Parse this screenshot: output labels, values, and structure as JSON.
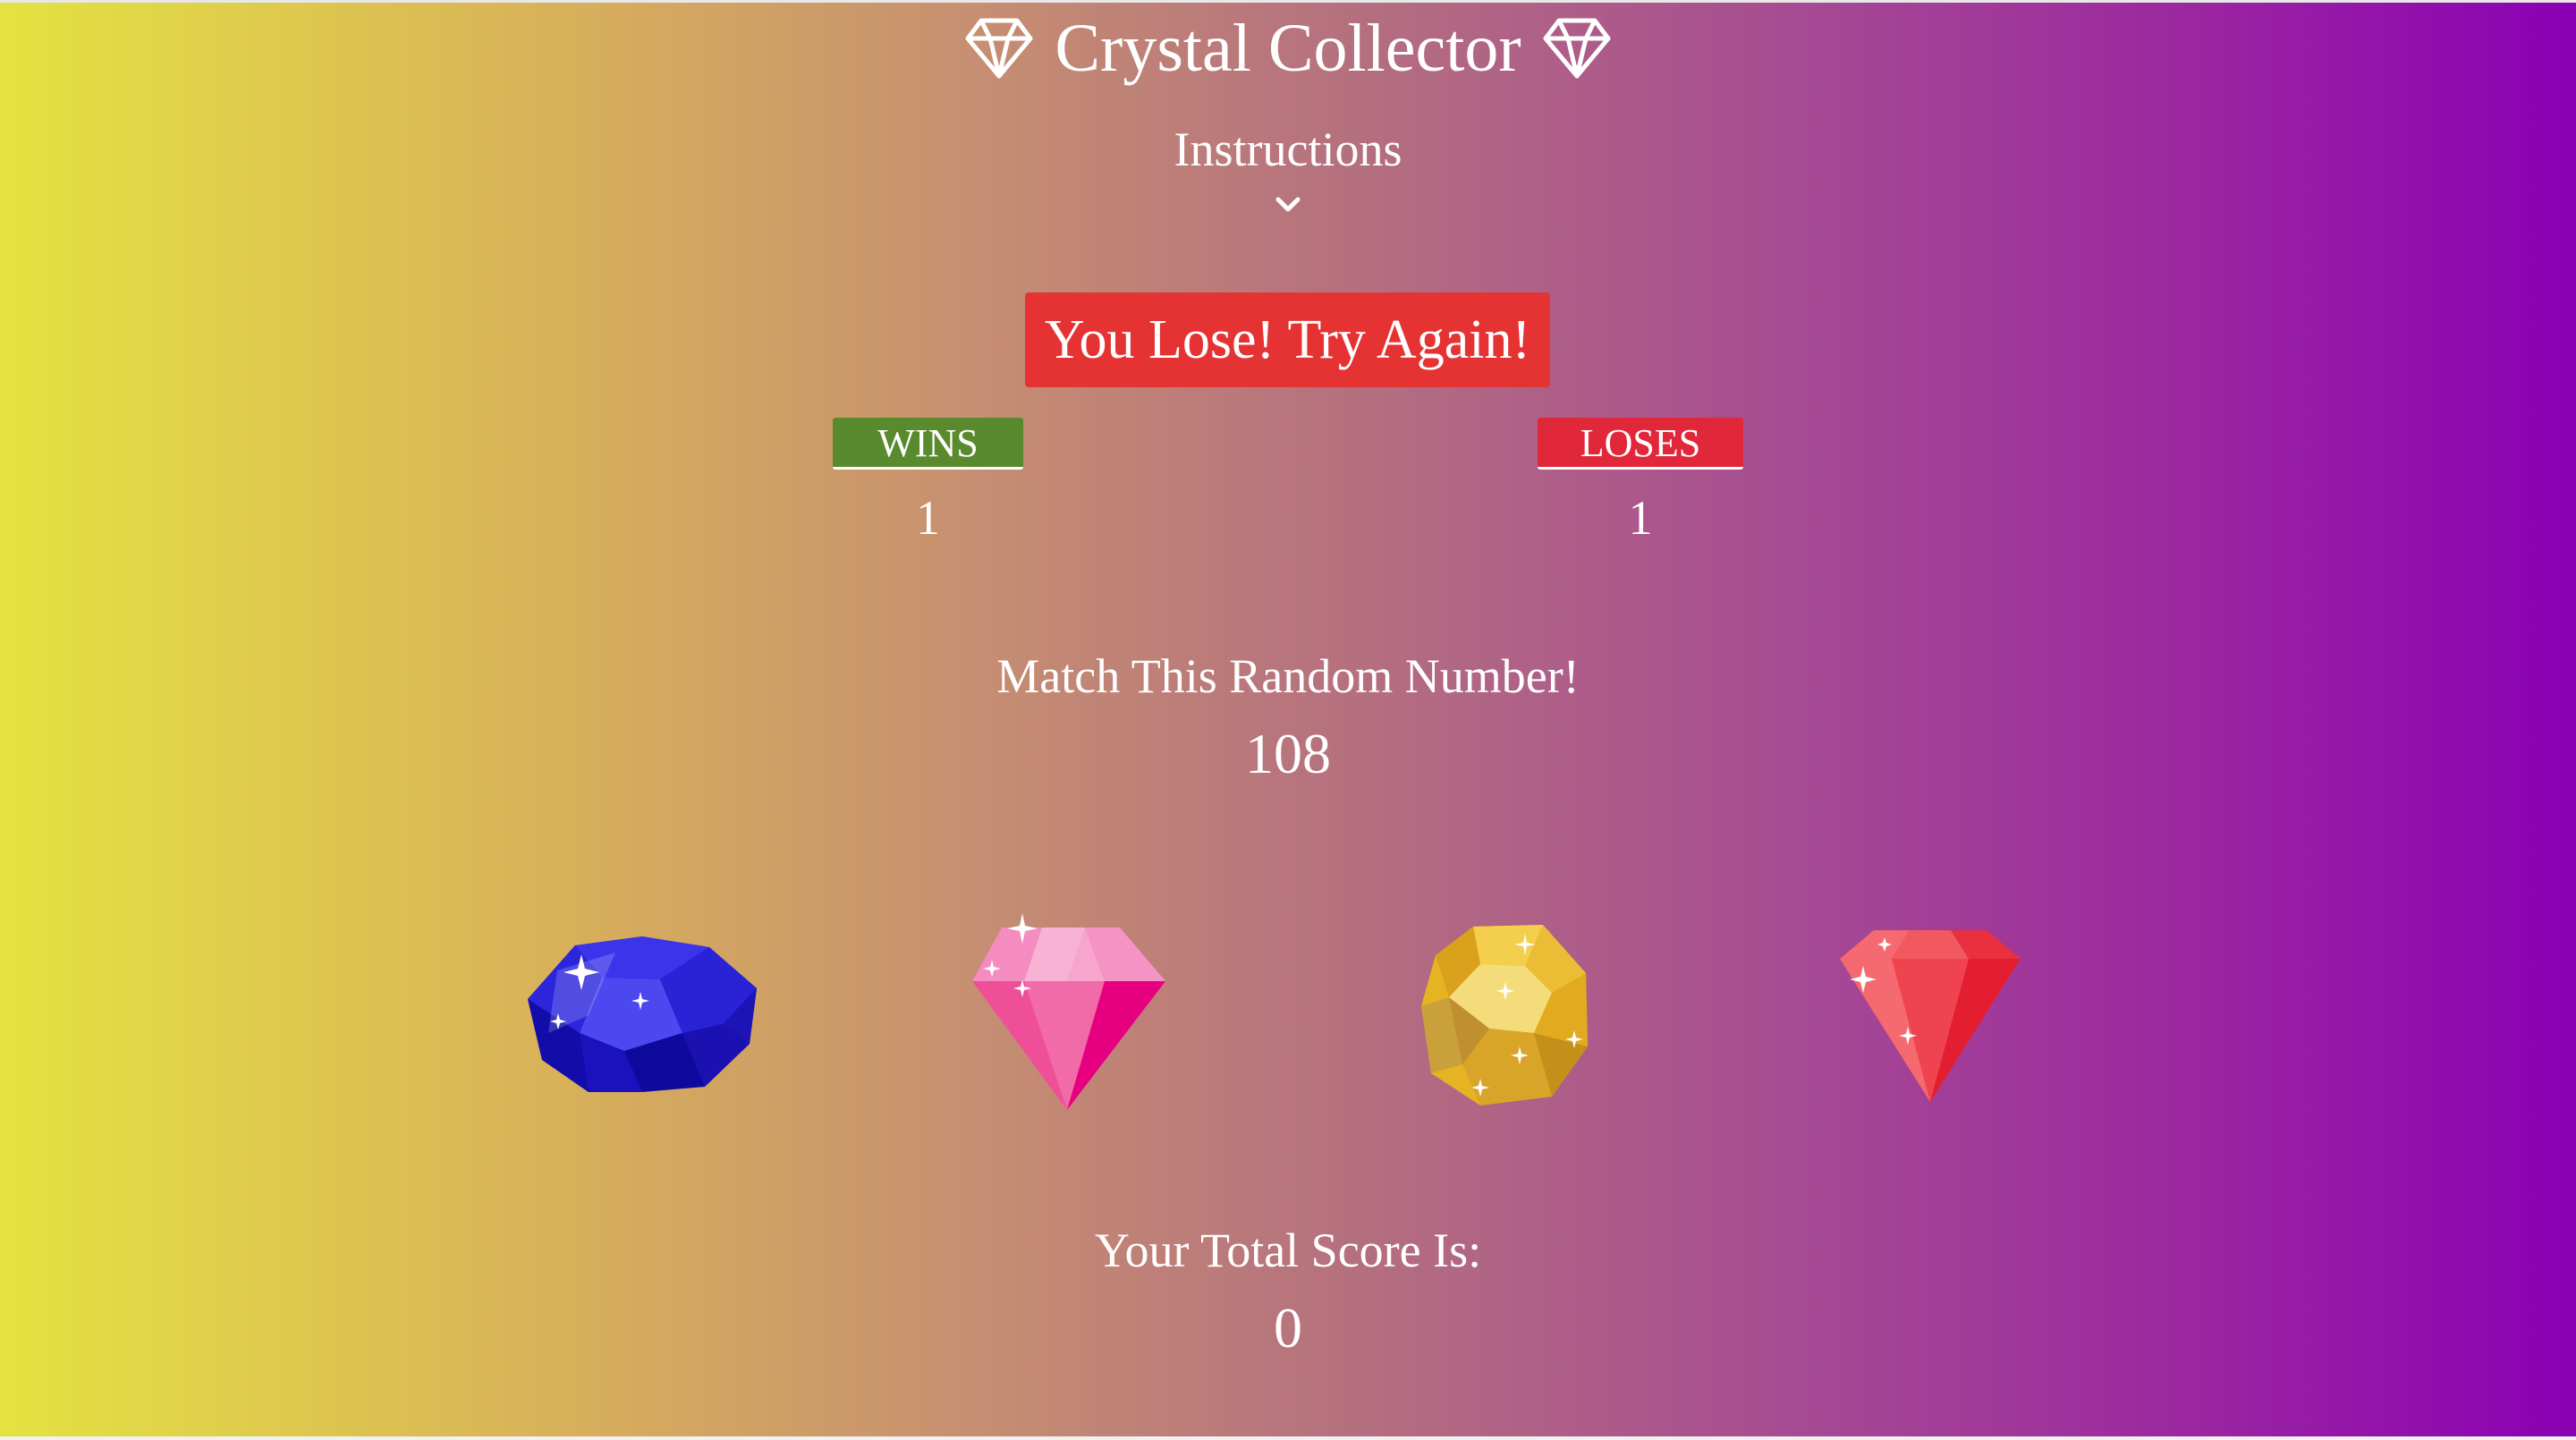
{
  "header": {
    "title": "Crystal Collector",
    "left_icon": "diamond-outline-icon",
    "right_icon": "diamond-outline-icon"
  },
  "instructions": {
    "label": "Instructions",
    "toggle_icon": "chevron-down-icon"
  },
  "status": {
    "message": "You Lose! Try Again!",
    "color": "#e53333"
  },
  "scoreboard": {
    "wins_label": "WINS",
    "wins_value": "1",
    "wins_color": "#5a8a2e",
    "loses_label": "LOSES",
    "loses_value": "1",
    "loses_color": "#e0283a"
  },
  "target": {
    "label": "Match This Random Number!",
    "value": "108"
  },
  "crystals": [
    {
      "name": "blue-crystal",
      "color": "#1a10d8",
      "icon": "blue-gem-icon"
    },
    {
      "name": "pink-crystal",
      "color": "#f06aa8",
      "icon": "pink-diamond-icon"
    },
    {
      "name": "yellow-crystal",
      "color": "#e8b526",
      "icon": "yellow-gem-icon"
    },
    {
      "name": "red-crystal",
      "color": "#ee3b48",
      "icon": "red-diamond-icon"
    }
  ],
  "score": {
    "label": "Your Total Score Is:",
    "value": "0"
  },
  "theme": {
    "gradient_start": "#e4e241",
    "gradient_end": "#8a00b4"
  }
}
